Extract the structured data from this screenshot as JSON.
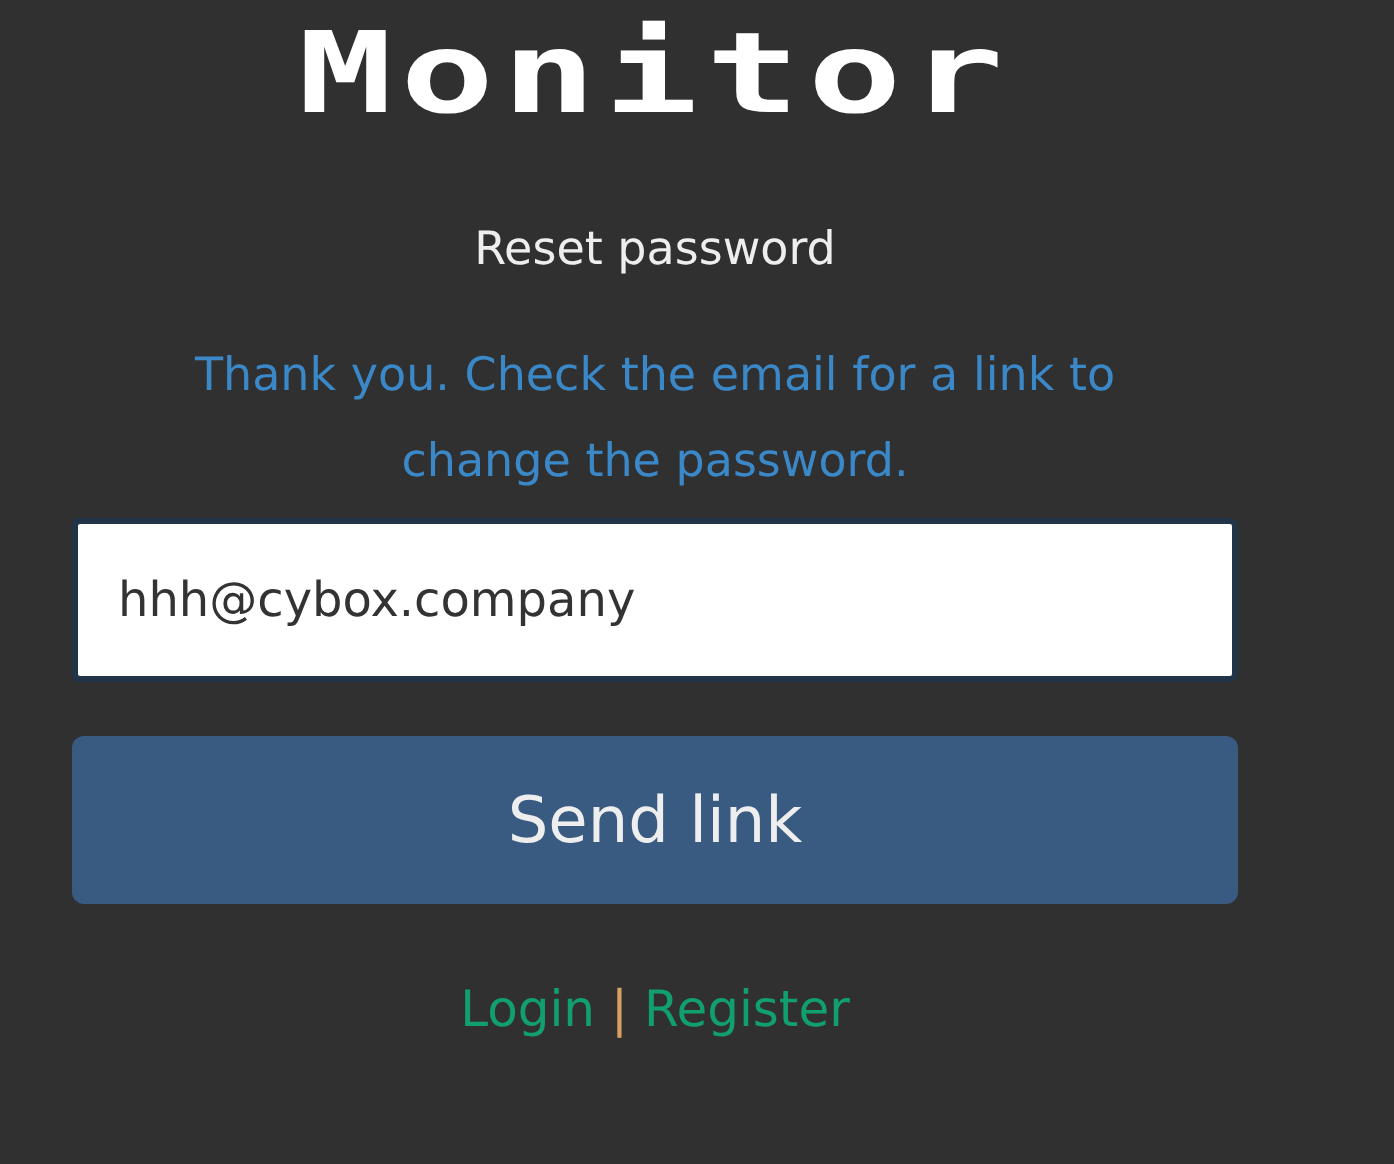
{
  "logo": "Monitor",
  "heading": "Reset password",
  "message": "Thank you. Check the email for a link to change the password.",
  "email_field": {
    "value": "hhh@cybox.company"
  },
  "submit_button": "Send link",
  "links": [
    {
      "label": "Login"
    },
    {
      "label": "Register"
    }
  ],
  "separator": "|"
}
